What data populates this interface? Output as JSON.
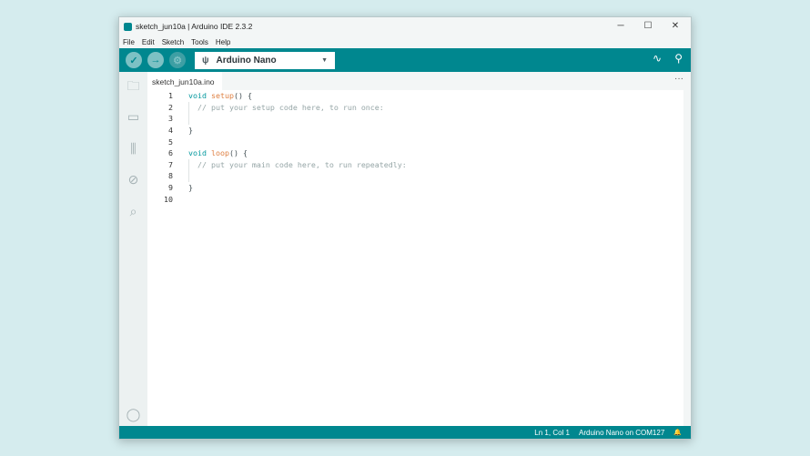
{
  "window": {
    "title": "sketch_jun10a | Arduino IDE 2.3.2",
    "minimize": "─",
    "maximize": "☐",
    "close": "✕"
  },
  "menu": [
    "File",
    "Edit",
    "Sketch",
    "Tools",
    "Help"
  ],
  "toolbar": {
    "verify": "✓",
    "upload": "→",
    "debug": "⚙",
    "board": "Arduino Nano",
    "usb": "ψ",
    "caret": "▼",
    "plotter": "∿",
    "monitor": "⚲"
  },
  "sidebar": {
    "sketchbook": "🗀",
    "boards": "▭",
    "library": "⫼",
    "debug": "⊘",
    "search": "⌕",
    "profile": "◯"
  },
  "tab": {
    "name": "sketch_jun10a.ino",
    "more": "···"
  },
  "code": [
    {
      "n": "1",
      "kw": "void",
      "fn": "setup",
      "rest": "() {",
      "cm": ""
    },
    {
      "n": "2",
      "kw": "",
      "fn": "",
      "rest": "",
      "cm": "  // put your setup code here, to run once:"
    },
    {
      "n": "3",
      "kw": "",
      "fn": "",
      "rest": "",
      "cm": ""
    },
    {
      "n": "4",
      "kw": "",
      "fn": "",
      "rest": "}",
      "cm": ""
    },
    {
      "n": "5",
      "kw": "",
      "fn": "",
      "rest": "",
      "cm": ""
    },
    {
      "n": "6",
      "kw": "void",
      "fn": "loop",
      "rest": "() {",
      "cm": ""
    },
    {
      "n": "7",
      "kw": "",
      "fn": "",
      "rest": "",
      "cm": "  // put your main code here, to run repeatedly:"
    },
    {
      "n": "8",
      "kw": "",
      "fn": "",
      "rest": "",
      "cm": ""
    },
    {
      "n": "9",
      "kw": "",
      "fn": "",
      "rest": "}",
      "cm": ""
    },
    {
      "n": "10",
      "kw": "",
      "fn": "",
      "rest": "",
      "cm": ""
    }
  ],
  "status": {
    "position": "Ln 1, Col 1",
    "board": "Arduino Nano on COM127",
    "bell": "🔔"
  }
}
